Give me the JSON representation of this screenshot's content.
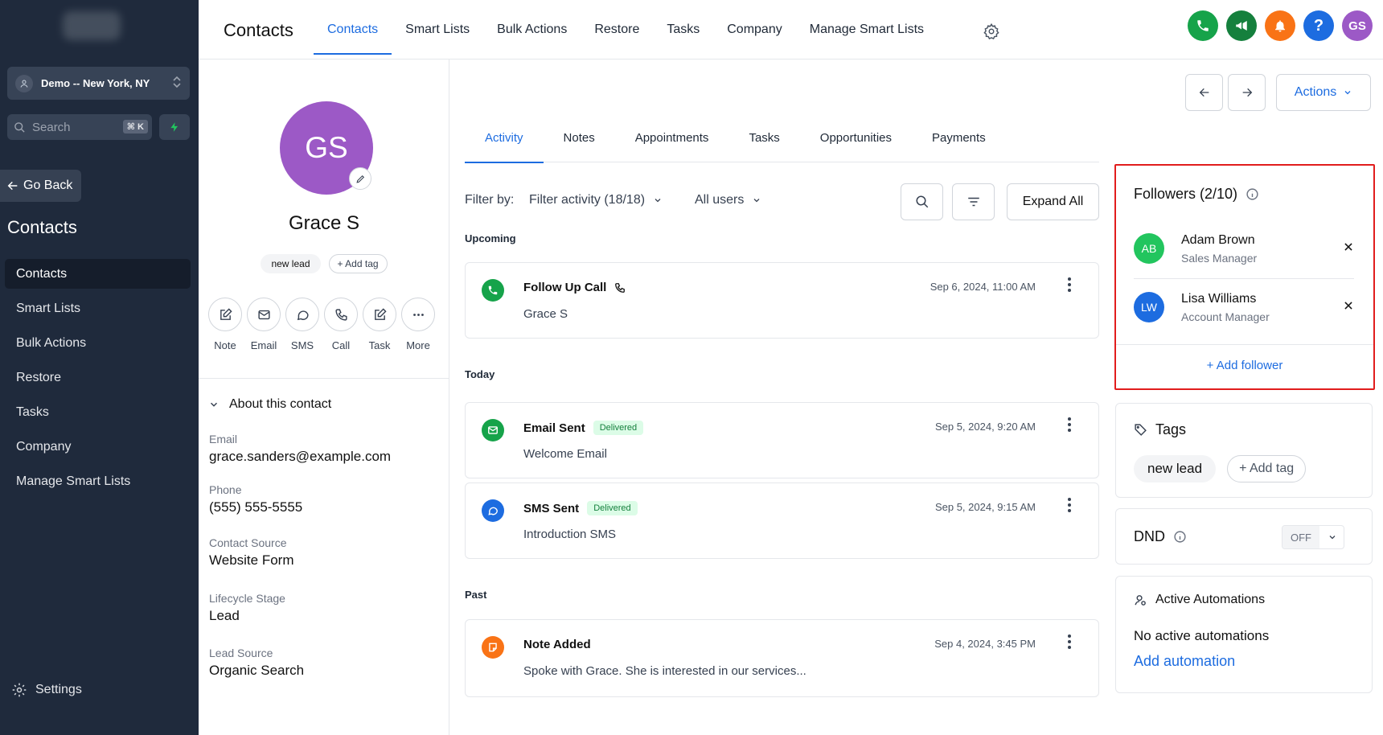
{
  "sidebar": {
    "location": "Demo -- New York, NY",
    "search_placeholder": "Search",
    "search_shortcut": "⌘ K",
    "go_back": "Go Back",
    "section_title": "Contacts",
    "items": [
      {
        "label": "Contacts",
        "active": true
      },
      {
        "label": "Smart Lists"
      },
      {
        "label": "Bulk Actions"
      },
      {
        "label": "Restore"
      },
      {
        "label": "Tasks"
      },
      {
        "label": "Company"
      },
      {
        "label": "Manage Smart Lists"
      }
    ],
    "settings": "Settings"
  },
  "topbar": {
    "title": "Contacts",
    "tabs": [
      "Contacts",
      "Smart Lists",
      "Bulk Actions",
      "Restore",
      "Tasks",
      "Company",
      "Manage Smart Lists"
    ],
    "active_tab": "Contacts",
    "user_initials": "GS",
    "help": "?",
    "icon_colors": {
      "phone": "#16a34a",
      "megaphone": "#15803d",
      "bell": "#f97316",
      "help": "#1d6ce0",
      "avatar": "#9c59c6"
    }
  },
  "contact": {
    "initials": "GS",
    "name": "Grace S",
    "tag": "new lead",
    "add_tag": "+ Add tag",
    "actions": [
      "Note",
      "Email",
      "SMS",
      "Call",
      "Task",
      "More"
    ],
    "about_title": "About this contact",
    "fields": [
      {
        "label": "Email",
        "value": "grace.sanders@example.com"
      },
      {
        "label": "Phone",
        "value": "(555) 555-5555"
      },
      {
        "label": "Contact Source",
        "value": "Website Form"
      },
      {
        "label": "Lifecycle Stage",
        "value": "Lead"
      },
      {
        "label": "Lead Source",
        "value": "Organic Search"
      }
    ]
  },
  "activity": {
    "tabs": [
      "Activity",
      "Notes",
      "Appointments",
      "Tasks",
      "Opportunities",
      "Payments"
    ],
    "active_tab": "Activity",
    "filter_label": "Filter by:",
    "filter_activity": "Filter activity (18/18)",
    "filter_users": "All users",
    "expand_all": "Expand All",
    "sections": {
      "upcoming": "Upcoming",
      "today": "Today",
      "past": "Past"
    },
    "items": [
      {
        "title": "Follow Up Call",
        "subtitle": "Grace S",
        "date": "Sep 6, 2024, 11:00 AM",
        "icon": "phone-icon",
        "color": "#16a34a"
      },
      {
        "title": "Email Sent",
        "badge": "Delivered",
        "subtitle": "Welcome Email",
        "date": "Sep 5, 2024, 9:20 AM",
        "icon": "mail-icon",
        "color": "#16a34a"
      },
      {
        "title": "SMS Sent",
        "badge": "Delivered",
        "subtitle": "Introduction SMS",
        "date": "Sep 5, 2024, 9:15 AM",
        "icon": "chat-icon",
        "color": "#1d6ce0"
      },
      {
        "title": "Note Added",
        "subtitle": "Spoke with Grace. She is interested in our services...",
        "date": "Sep 4, 2024, 3:45 PM",
        "icon": "note-icon",
        "color": "#f97316"
      }
    ]
  },
  "right": {
    "actions_label": "Actions",
    "followers": {
      "title": "Followers (2/10)",
      "people": [
        {
          "initials": "AB",
          "name": "Adam Brown",
          "role": "Sales Manager",
          "color": "#22c55e"
        },
        {
          "initials": "LW",
          "name": "Lisa Williams",
          "role": "Account Manager",
          "color": "#1d6ce0"
        }
      ],
      "add": "+ Add follower"
    },
    "tags": {
      "title": "Tags",
      "tag": "new lead",
      "add": "+ Add tag"
    },
    "dnd": {
      "title": "DND",
      "value": "OFF"
    },
    "automations": {
      "title": "Active Automations",
      "empty": "No active automations",
      "add": "Add automation"
    }
  }
}
